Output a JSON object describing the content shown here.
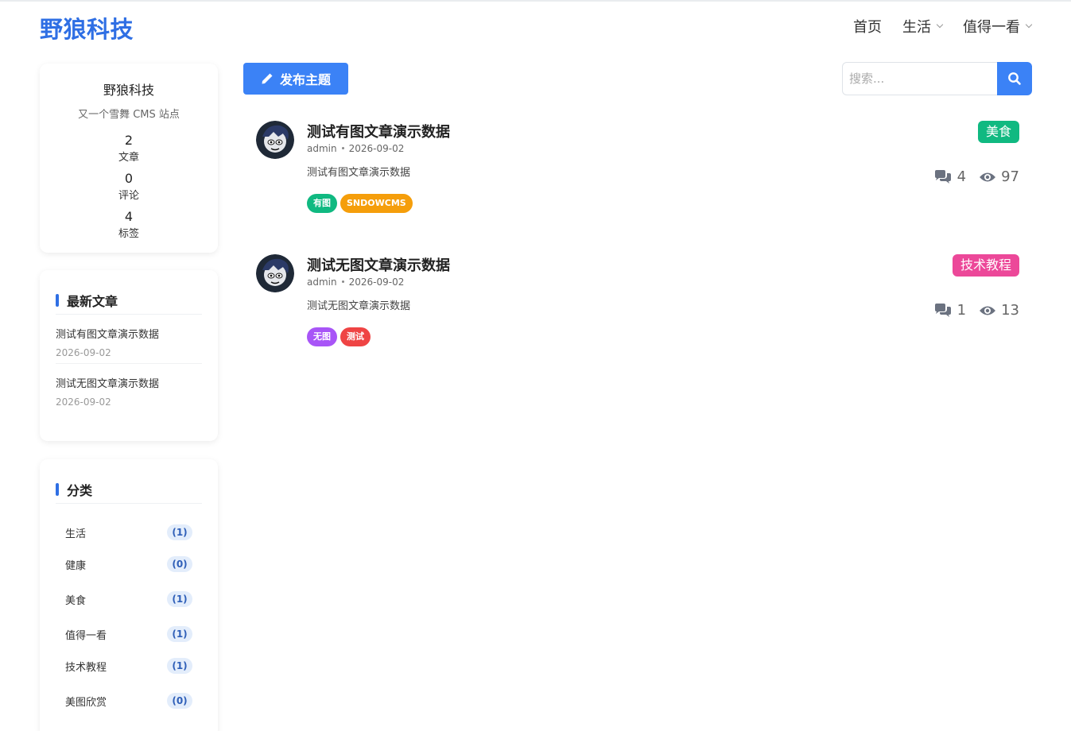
{
  "header": {
    "logo": "野狼科技",
    "nav": [
      {
        "label": "首页",
        "dropdown": false
      },
      {
        "label": "生活",
        "dropdown": true
      },
      {
        "label": "值得一看",
        "dropdown": true
      }
    ]
  },
  "profile": {
    "name": "野狼科技",
    "description": "又一个雪舞 CMS 站点",
    "stats": [
      {
        "value": "2",
        "label": "文章"
      },
      {
        "value": "0",
        "label": "评论"
      },
      {
        "value": "4",
        "label": "标签"
      }
    ]
  },
  "recent": {
    "title": "最新文章",
    "items": [
      {
        "title": "测试有图文章演示数据",
        "date": "2026-09-02"
      },
      {
        "title": "测试无图文章演示数据",
        "date": "2026-09-02"
      }
    ]
  },
  "categories": {
    "title": "分类",
    "items": [
      {
        "name": "生活",
        "count": "(1)"
      },
      {
        "name": "健康",
        "count": "(0)"
      },
      {
        "name": "美食",
        "count": "(1)"
      },
      {
        "name": "值得一看",
        "count": "(1)"
      },
      {
        "name": "技术教程",
        "count": "(1)"
      },
      {
        "name": "美图欣赏",
        "count": "(0)"
      }
    ]
  },
  "toolbar": {
    "post_button": "发布主题",
    "search_placeholder": "搜索..."
  },
  "posts": [
    {
      "title": "测试有图文章演示数据",
      "author": "admin",
      "date": "2026-09-02",
      "excerpt": "测试有图文章演示数据",
      "category": "美食",
      "category_color": "#10b981",
      "comments": "4",
      "views": "97",
      "tags": [
        {
          "label": "有图",
          "color": "#10b981"
        },
        {
          "label": "SNDOWCMS",
          "color": "#f59e0b"
        }
      ]
    },
    {
      "title": "测试无图文章演示数据",
      "author": "admin",
      "date": "2026-09-02",
      "excerpt": "测试无图文章演示数据",
      "category": "技术教程",
      "category_color": "#ec4899",
      "comments": "1",
      "views": "13",
      "tags": [
        {
          "label": "无图",
          "color": "#a855f7"
        },
        {
          "label": "测试",
          "color": "#ef4444"
        }
      ]
    }
  ],
  "colors": {
    "accent": "#3b82f6",
    "logo": "#2f6fe4"
  }
}
